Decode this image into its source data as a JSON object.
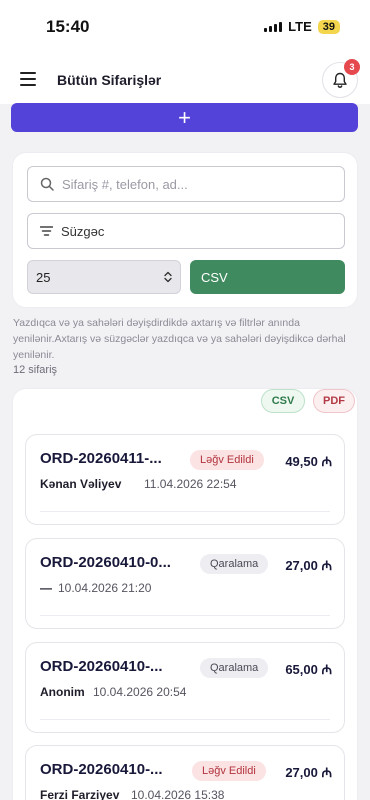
{
  "status_bar": {
    "time": "15:40",
    "network": "LTE",
    "battery": "39"
  },
  "header": {
    "title": "Bütün Sifarişlər",
    "notification_count": "3"
  },
  "add_button": {
    "label": "+"
  },
  "filters": {
    "search_placeholder": "Sifariş #, telefon, ad...",
    "filter_label": "Süzgəc",
    "page_size": "25",
    "csv_label": "CSV"
  },
  "hint_text": "Yazdıqca və ya sahələri dəyişdirdikdə axtarış və filtrlər anında yenilənir.Axtarış və süzgəclər yazdıqca və ya sahələri dəyişdikcə dərhal yenilənir.",
  "order_count": "12 sifariş",
  "export": {
    "csv": "CSV",
    "pdf": "PDF"
  },
  "orders": [
    {
      "id": "ORD-20260411-...",
      "status": "Ləğv Edildi",
      "amount": "49,50 ₼",
      "customer": "Kənan Vəliyev",
      "date": "11.04.2026 22:54"
    },
    {
      "id": "ORD-20260410-0...",
      "status": "Qaralama",
      "amount": "27,00 ₼",
      "customer": "—",
      "date": "10.04.2026 21:20"
    },
    {
      "id": "ORD-20260410-...",
      "status": "Qaralama",
      "amount": "65,00 ₼",
      "customer": "Anonim",
      "date": "10.04.2026 20:54"
    },
    {
      "id": "ORD-20260410-...",
      "status": "Ləğv Edildi",
      "amount": "27,00 ₼",
      "customer": "Ferzi Farziyev",
      "date": "10.04.2026 15:38"
    }
  ]
}
